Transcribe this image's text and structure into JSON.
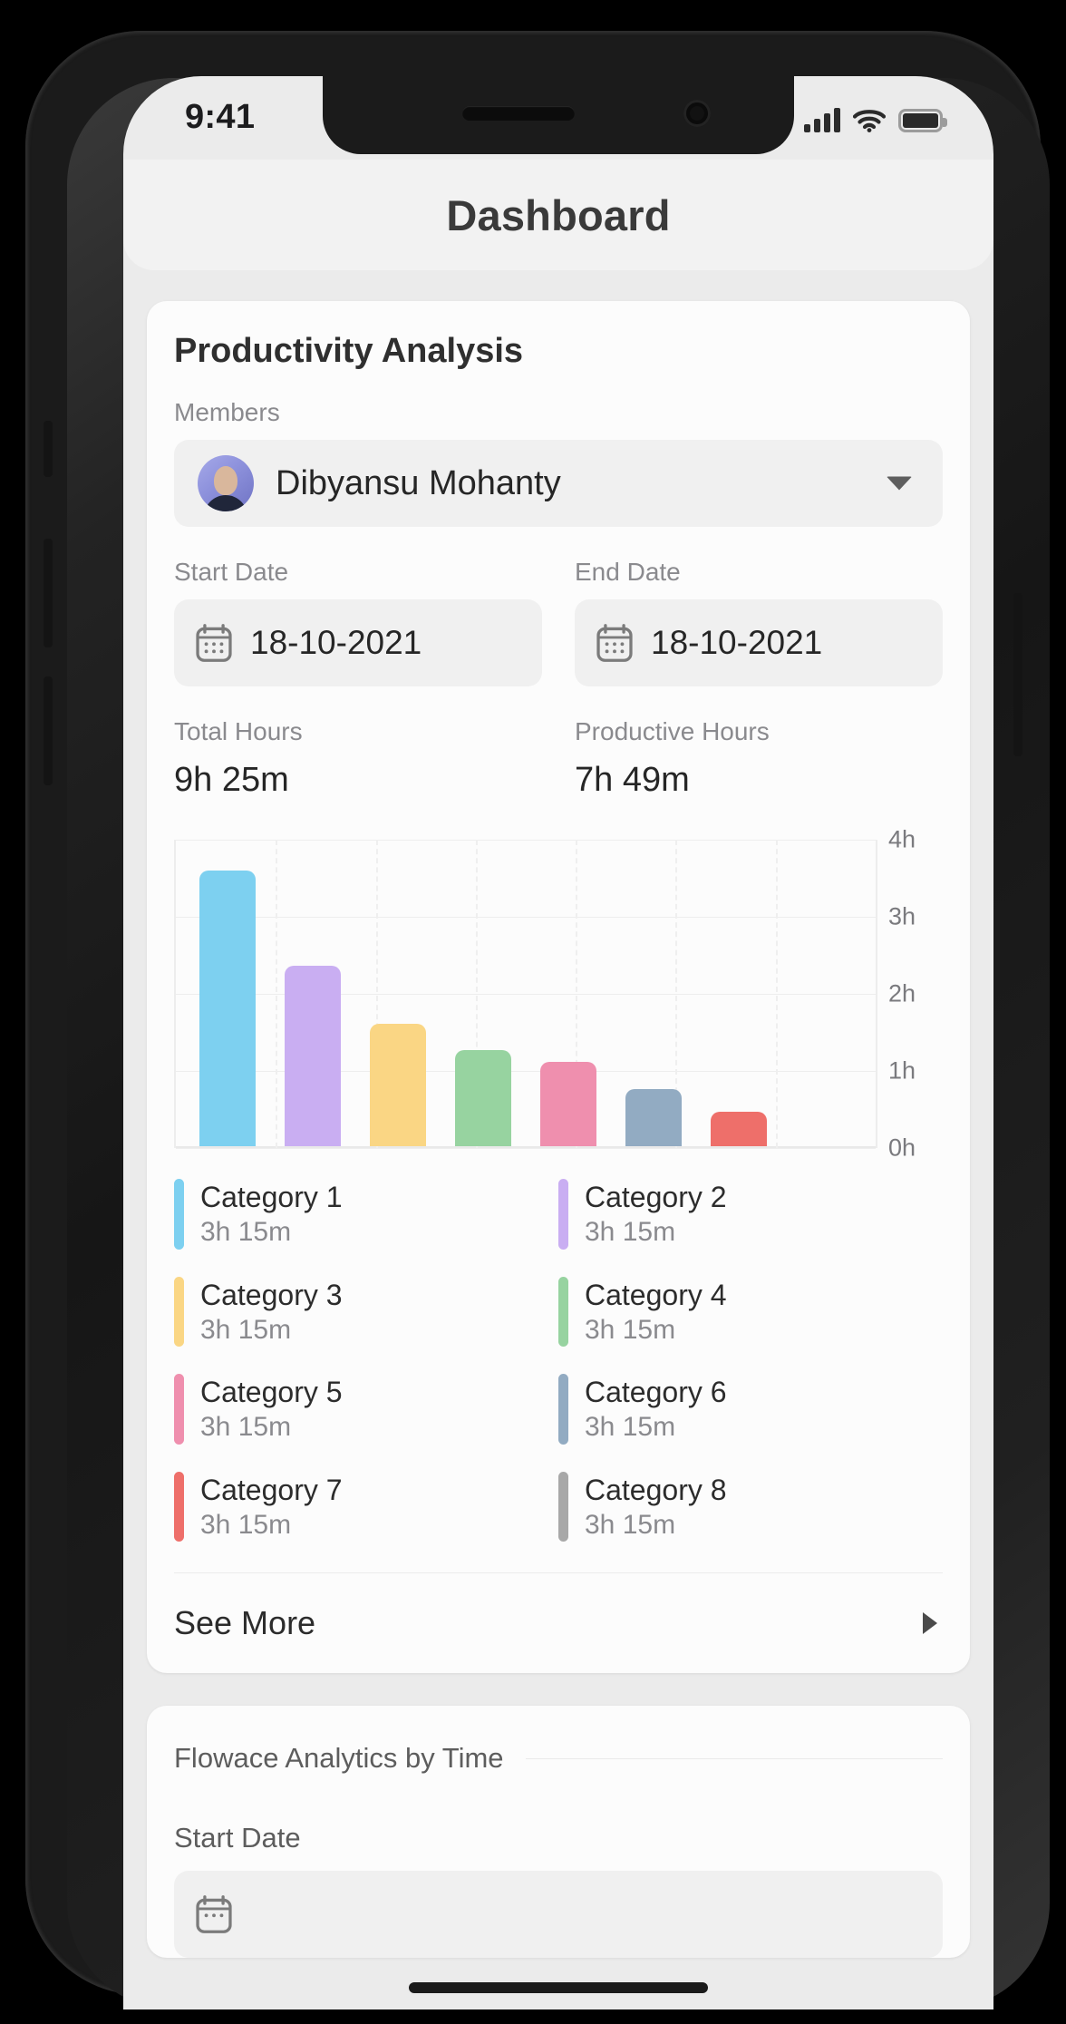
{
  "status_bar": {
    "time": "9:41",
    "signal_icon": "cellular-signal-icon",
    "wifi_icon": "wifi-icon",
    "battery_icon": "battery-full-icon"
  },
  "header": {
    "title": "Dashboard"
  },
  "productivity_card": {
    "title": "Productivity Analysis",
    "members_label": "Members",
    "member_selected": "Dibyansu Mohanty",
    "member_avatar": "user-avatar",
    "dropdown_icon": "chevron-down-icon",
    "start_date_label": "Start Date",
    "start_date_value": "18-10-2021",
    "end_date_label": "End Date",
    "end_date_value": "18-10-2021",
    "calendar_icon": "calendar-icon",
    "total_hours_label": "Total Hours",
    "total_hours_value": "9h 25m",
    "productive_hours_label": "Productive Hours",
    "productive_hours_value": "7h 49m",
    "see_more_label": "See More",
    "see_more_icon": "triangle-right-icon"
  },
  "chart_data": {
    "type": "bar",
    "title": "",
    "xlabel": "",
    "ylabel": "",
    "ylim": [
      0,
      4
    ],
    "grid": true,
    "y_axis_position": "right",
    "legend_position": "below",
    "tick_labels": [
      "4h",
      "3h",
      "2h",
      "1h",
      "0h"
    ],
    "tick_values": [
      4,
      3,
      2,
      1,
      0
    ],
    "categories": [
      "Category 1",
      "Category 2",
      "Category 3",
      "Category 4",
      "Category 5",
      "Category 6",
      "Category 7",
      "Category 8"
    ],
    "values": [
      3.6,
      2.35,
      1.6,
      1.25,
      1.1,
      0.75,
      0.45,
      0
    ],
    "value_labels": [
      "3h 15m",
      "3h 15m",
      "3h 15m",
      "3h 15m",
      "3h 15m",
      "3h 15m",
      "3h 15m",
      "3h 15m"
    ],
    "colors": [
      "#7dd0f0",
      "#c9aef2",
      "#fad684",
      "#97d3a0",
      "#ef8fae",
      "#92abc2",
      "#ee6f6a",
      "#a8a8a8"
    ]
  },
  "bottom_card": {
    "section_title": "Flowace Analytics by Time",
    "start_date_label": "Start Date",
    "calendar_icon": "calendar-icon"
  }
}
